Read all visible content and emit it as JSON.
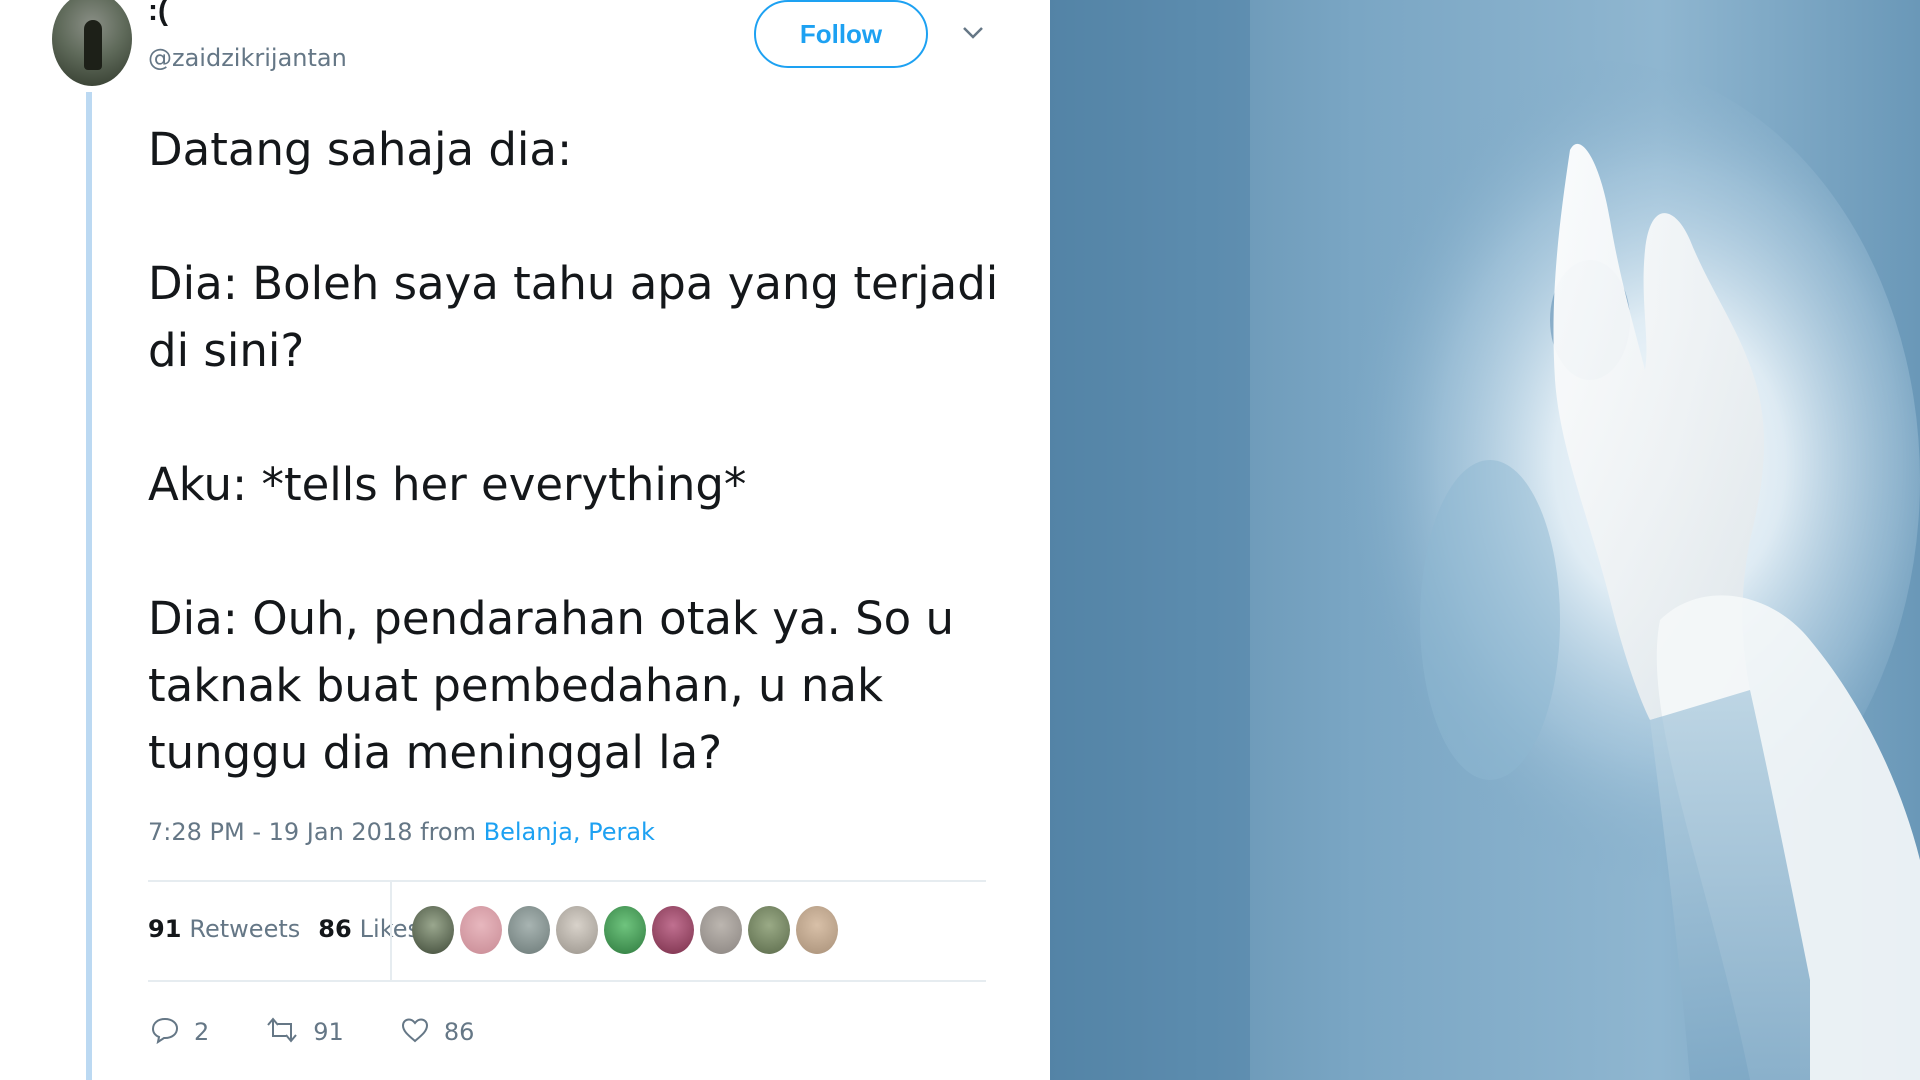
{
  "tweet": {
    "display_name": ":(",
    "username": "@zaidzikrijantan",
    "follow_label": "Follow",
    "body": [
      "Datang sahaja dia:",
      "Dia: Boleh saya tahu apa yang terjadi di sini?",
      "Aku: *tells her everything*",
      "Dia: Ouh, pendarahan otak ya. So u taknak buat pembedahan, u nak tunggu dia meninggal la?"
    ],
    "timestamp": "7:28 PM - 19 Jan 2018 from",
    "location": "Belanja, Perak",
    "retweet_count": "91",
    "retweets_label": "Retweets",
    "like_count": "86",
    "likes_label": "Likes",
    "actions": {
      "reply_count": "2",
      "retweet_count": "91",
      "like_count": "86"
    }
  },
  "colors": {
    "accent": "#1da1f2",
    "muted": "#657786",
    "thread_line": "#bcd9f2",
    "liker_avatars": [
      "#3f4a38",
      "#c88a94",
      "#6c7a78",
      "#9a948c",
      "#2e7a3e",
      "#7a2f4a",
      "#8a8480",
      "#5a6a4a",
      "#a89078"
    ]
  },
  "icons": [
    "caret-down-icon",
    "reply-icon",
    "retweet-icon",
    "heart-icon"
  ],
  "photo": {
    "subject": "surgeon-gloved-hand-under-surgical-light"
  }
}
